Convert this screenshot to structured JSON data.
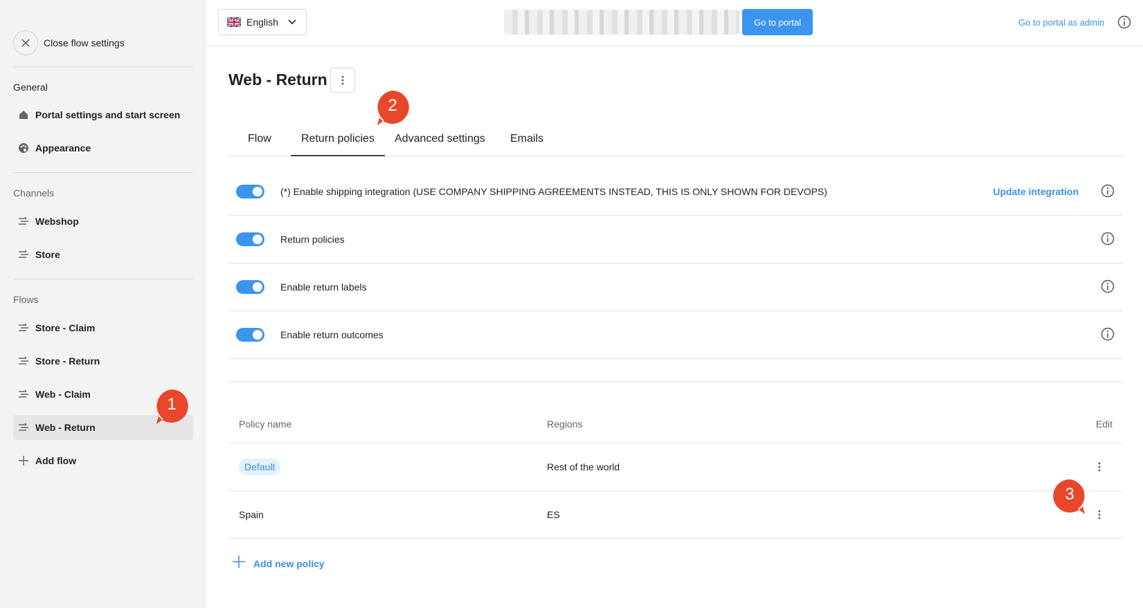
{
  "sidebar": {
    "close_label": "Close flow settings",
    "general_title": "General",
    "general_items": [
      {
        "label": "Portal settings and start screen",
        "icon": "home-icon"
      },
      {
        "label": "Appearance",
        "icon": "palette-icon"
      }
    ],
    "channels_title": "Channels",
    "channel_items": [
      {
        "label": "Webshop",
        "icon": "flow-icon"
      },
      {
        "label": "Store",
        "icon": "flow-icon"
      }
    ],
    "flows_title": "Flows",
    "flow_items": [
      {
        "label": "Store - Claim",
        "icon": "flow-icon"
      },
      {
        "label": "Store - Return",
        "icon": "flow-icon"
      },
      {
        "label": "Web - Claim",
        "icon": "flow-icon"
      },
      {
        "label": "Web - Return",
        "icon": "flow-icon",
        "active": true
      }
    ],
    "add_flow_label": "Add flow"
  },
  "topbar": {
    "language": "English",
    "portal_button": "Go to portal",
    "admin_link": "Go to portal as admin"
  },
  "main": {
    "title": "Web - Return",
    "tabs": [
      {
        "label": "Flow"
      },
      {
        "label": "Return policies",
        "active": true
      },
      {
        "label": "Advanced settings"
      },
      {
        "label": "Emails"
      }
    ],
    "toggles": [
      {
        "label": "(*) Enable shipping integration (USE COMPANY SHIPPING AGREEMENTS INSTEAD, THIS IS ONLY SHOWN FOR DEVOPS)",
        "on": true,
        "action": "Update integration"
      },
      {
        "label": "Return policies",
        "on": true
      },
      {
        "label": "Enable return labels",
        "on": true
      },
      {
        "label": "Enable return outcomes",
        "on": true
      }
    ],
    "table": {
      "headers": [
        "Policy name",
        "Regions",
        "Edit"
      ],
      "rows": [
        {
          "name": "Default",
          "is_badge": true,
          "regions": "Rest of the world"
        },
        {
          "name": "Spain",
          "is_badge": false,
          "regions": "ES"
        }
      ]
    },
    "add_policy_label": "Add new policy"
  },
  "markers": [
    "1",
    "2",
    "3"
  ],
  "colors": {
    "accent": "#3b95f0",
    "link": "#3b8fe0",
    "marker": "#e8472b",
    "sidebar_bg": "#f3f3f3"
  }
}
